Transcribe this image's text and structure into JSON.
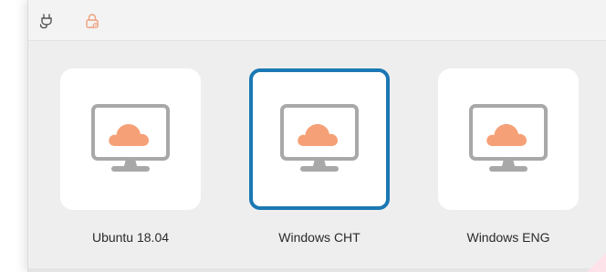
{
  "toolbar": {
    "connect_icon": "plug-icon",
    "lock_icon": "lock-icon"
  },
  "colors": {
    "accent": "#1a78b4",
    "cloud": "#f6a077",
    "monitor": "#a8a8a8"
  },
  "vms": [
    {
      "name": "Ubuntu 18.04",
      "icon": "monitor-cloud-icon",
      "selected": false
    },
    {
      "name": "Windows CHT",
      "icon": "monitor-cloud-icon",
      "selected": true
    },
    {
      "name": "Windows ENG",
      "icon": "monitor-cloud-icon",
      "selected": false
    }
  ]
}
